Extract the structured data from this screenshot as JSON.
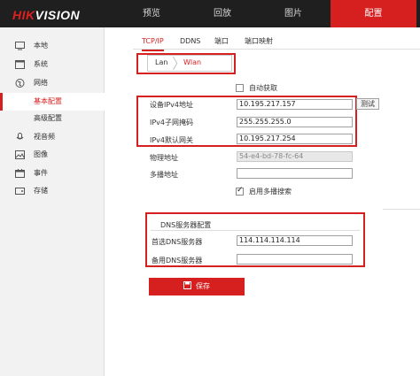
{
  "brand": {
    "prefix": "HIK",
    "suffix": "VISION"
  },
  "top_nav": [
    {
      "label": "预览"
    },
    {
      "label": "回放"
    },
    {
      "label": "图片"
    },
    {
      "label": "配置"
    }
  ],
  "sidebar": {
    "items": [
      {
        "label": "本地",
        "icon": "monitor-icon"
      },
      {
        "label": "系统",
        "icon": "window-icon"
      },
      {
        "label": "网络",
        "icon": "globe-icon"
      },
      {
        "label": "基本配置",
        "selected": true
      },
      {
        "label": "高级配置"
      },
      {
        "label": "视音频",
        "icon": "microphone-icon"
      },
      {
        "label": "图像",
        "icon": "image-icon"
      },
      {
        "label": "事件",
        "icon": "calendar-icon"
      },
      {
        "label": "存储",
        "icon": "disk-icon"
      }
    ]
  },
  "tabs": [
    {
      "label": "TCP/IP",
      "active": true
    },
    {
      "label": "DDNS"
    },
    {
      "label": "端口"
    },
    {
      "label": "端口映射"
    }
  ],
  "breadcrumb": {
    "lan": "Lan",
    "wlan": "Wlan"
  },
  "form": {
    "auto_obtain_label": "自动获取",
    "ipv4_address_label": "设备IPv4地址",
    "ipv4_address_value": "10.195.217.157",
    "test_label": "测试",
    "subnet_mask_label": "IPv4子网掩码",
    "subnet_mask_value": "255.255.255.0",
    "gateway_label": "IPv4默认网关",
    "gateway_value": "10.195.217.254",
    "mac_label": "物理地址",
    "mac_value": "54-e4-bd-78-fc-64",
    "multicast_label": "多播地址",
    "multicast_value": "",
    "multicast_search_label": "启用多播搜索"
  },
  "dns": {
    "title": "DNS服务器配置",
    "preferred_label": "首选DNS服务器",
    "preferred_value": "114.114.114.114",
    "alternate_label": "备用DNS服务器",
    "alternate_value": ""
  },
  "save_label": "保存",
  "colors": {
    "accent": "#d61f1f",
    "topbar": "#1f1f1f",
    "sidebar": "#f2f2f2"
  }
}
